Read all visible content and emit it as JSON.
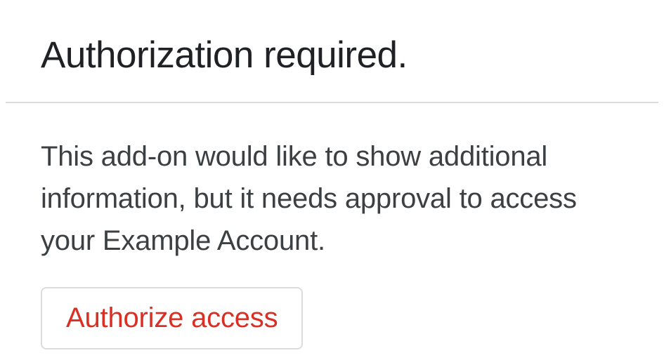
{
  "header": {
    "title": "Authorization required."
  },
  "body": {
    "description": "This add-on would like to show additional information, but it needs approval to access your Example Account.",
    "authorize_label": "Authorize access"
  }
}
